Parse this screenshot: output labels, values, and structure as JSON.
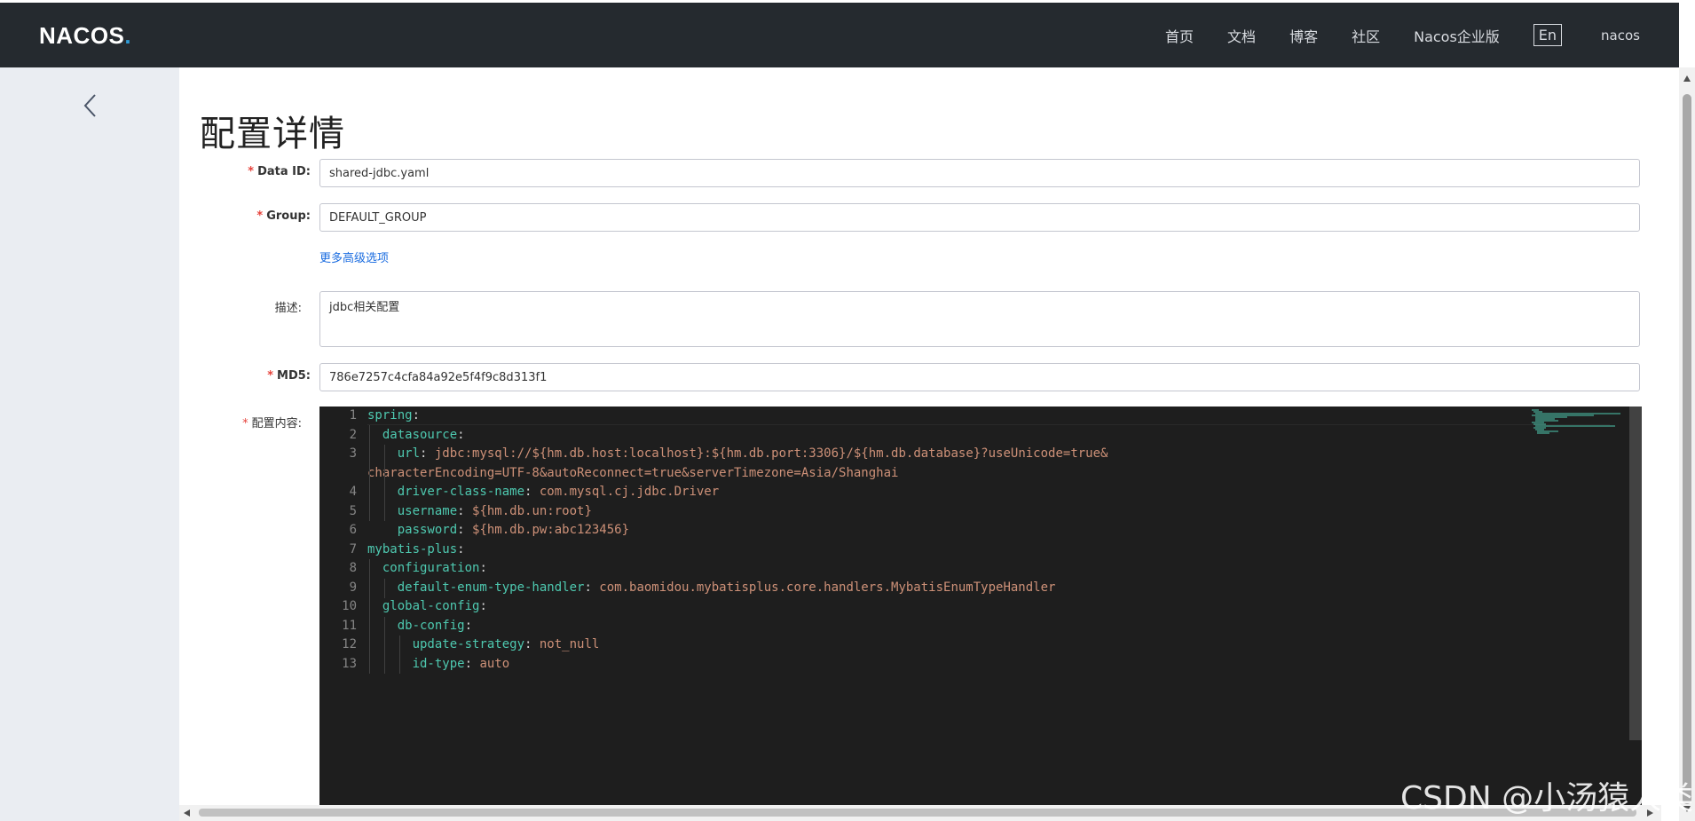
{
  "app": {
    "logo": "NACOS",
    "logo_dot": "."
  },
  "nav": {
    "items": [
      "首页",
      "文档",
      "博客",
      "社区",
      "Nacos企业版"
    ],
    "lang": "En",
    "user": "nacos"
  },
  "page": {
    "title": "配置详情"
  },
  "form": {
    "data_id": {
      "label": "Data ID:",
      "value": "shared-jdbc.yaml",
      "required": true
    },
    "group": {
      "label": "Group:",
      "value": "DEFAULT_GROUP",
      "required": true
    },
    "advanced_link": "更多高级选项",
    "description": {
      "label": "描述:",
      "value": "jdbc相关配置"
    },
    "md5": {
      "label": "MD5:",
      "value": "786e7257c4cfa84a92e5f4f9c8d313f1",
      "required": true
    },
    "content": {
      "label": "配置内容:",
      "required": true
    }
  },
  "editor": {
    "lines": [
      {
        "n": "1",
        "key": "spring",
        "sep": ":",
        "val": ""
      },
      {
        "n": "2",
        "key": "  datasource",
        "sep": ":",
        "val": ""
      },
      {
        "n": "3",
        "key": "    url",
        "sep": ": ",
        "val": "jdbc:mysql://${hm.db.host:localhost}:${hm.db.port:3306}/${hm.db.database}?useUnicode=true&"
      },
      {
        "n": "",
        "key": "",
        "sep": "",
        "val": "characterEncoding=UTF-8&autoReconnect=true&serverTimezone=Asia/Shanghai"
      },
      {
        "n": "4",
        "key": "    driver-class-name",
        "sep": ": ",
        "val": "com.mysql.cj.jdbc.Driver"
      },
      {
        "n": "5",
        "key": "    username",
        "sep": ": ",
        "val": "${hm.db.un:root}"
      },
      {
        "n": "6",
        "key": "    password",
        "sep": ": ",
        "val": "${hm.db.pw:abc123456}"
      },
      {
        "n": "7",
        "key": "mybatis-plus",
        "sep": ":",
        "val": ""
      },
      {
        "n": "8",
        "key": "  configuration",
        "sep": ":",
        "val": ""
      },
      {
        "n": "9",
        "key": "    default-enum-type-handler",
        "sep": ": ",
        "val": "com.baomidou.mybatisplus.core.handlers.MybatisEnumTypeHandler"
      },
      {
        "n": "10",
        "key": "  global-config",
        "sep": ":",
        "val": ""
      },
      {
        "n": "11",
        "key": "    db-config",
        "sep": ":",
        "val": ""
      },
      {
        "n": "12",
        "key": "      update-strategy",
        "sep": ": ",
        "val": "not_null"
      },
      {
        "n": "13",
        "key": "      id-type",
        "sep": ": ",
        "val": "auto"
      }
    ]
  },
  "watermark": "CSDN @小汤猿人类",
  "icons": {
    "back": "chevron-left-icon"
  }
}
